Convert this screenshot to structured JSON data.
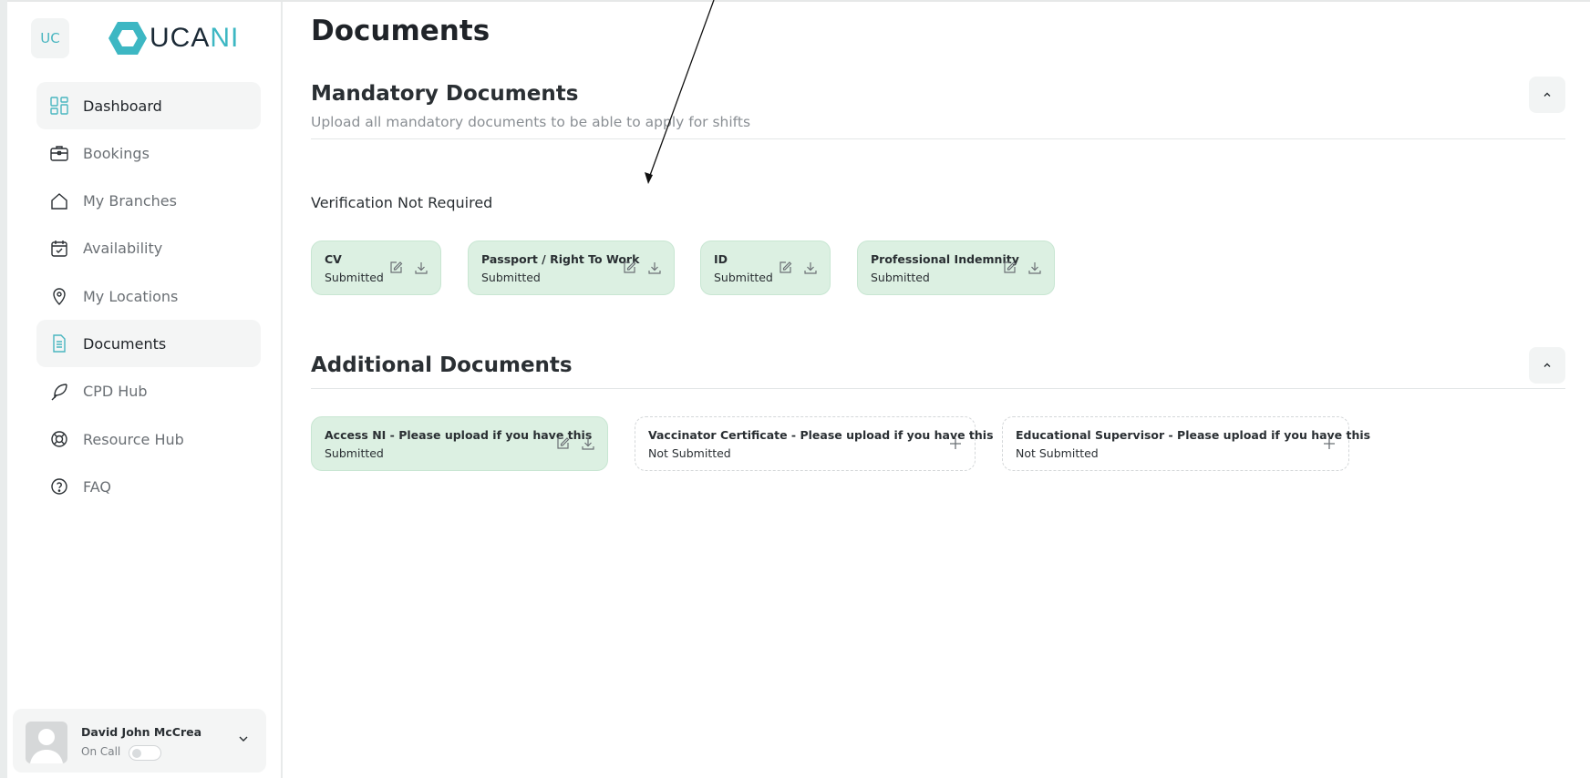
{
  "brand": {
    "initials": "UC",
    "logo_part1": "UCA",
    "logo_part2": "NI",
    "accent": "#3db7c3"
  },
  "sidebar": {
    "items": [
      {
        "label": "Dashboard",
        "icon": "dashboard-grid-icon"
      },
      {
        "label": "Bookings",
        "icon": "briefcase-icon"
      },
      {
        "label": "My Branches",
        "icon": "home-icon"
      },
      {
        "label": "Availability",
        "icon": "calendar-check-icon"
      },
      {
        "label": "My Locations",
        "icon": "location-pin-icon"
      },
      {
        "label": "Documents",
        "icon": "document-icon"
      },
      {
        "label": "CPD Hub",
        "icon": "feather-icon"
      },
      {
        "label": "Resource Hub",
        "icon": "lifebuoy-icon"
      },
      {
        "label": "FAQ",
        "icon": "question-circle-icon"
      }
    ]
  },
  "user": {
    "name": "David John McCrea",
    "status_label": "On Call",
    "on_call": false
  },
  "main": {
    "title": "Documents",
    "mandatory": {
      "title": "Mandatory Documents",
      "subtitle": "Upload all mandatory documents to be able to apply for shifts",
      "group_label": "Verification Not Required",
      "documents": [
        {
          "name": "CV",
          "status": "Submitted"
        },
        {
          "name": "Passport / Right To Work",
          "status": "Submitted"
        },
        {
          "name": "ID",
          "status": "Submitted"
        },
        {
          "name": "Professional Indemnity",
          "status": "Submitted"
        }
      ]
    },
    "additional": {
      "title": "Additional Documents",
      "documents": [
        {
          "name": "Access NI - Please upload if you have this",
          "status": "Submitted"
        },
        {
          "name": "Vaccinator Certificate - Please upload if you have this",
          "status": "Not Submitted"
        },
        {
          "name": "Educational Supervisor - Please upload if you have this",
          "status": "Not Submitted"
        }
      ]
    }
  },
  "colors": {
    "submitted_card": "#dcf0e2",
    "active_nav": "#f4f5f5",
    "muted_text": "#6b7075"
  }
}
